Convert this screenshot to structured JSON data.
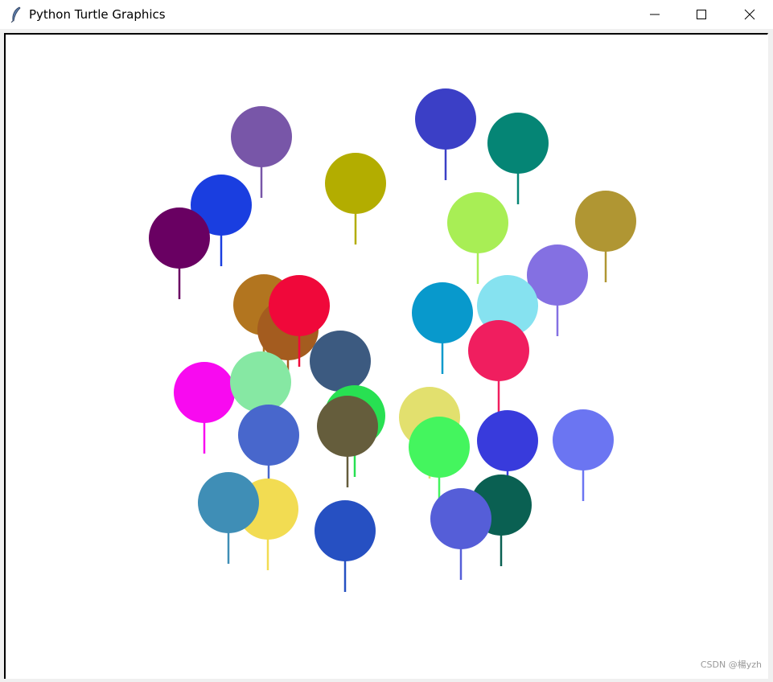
{
  "window": {
    "title": "Python Turtle Graphics",
    "icon": "feather-icon",
    "controls": [
      "minimize-icon",
      "maximize-icon",
      "close-icon"
    ]
  },
  "canvas": {
    "background": "#ffffff",
    "balloons": [
      {
        "color": "#7856a8"
      },
      {
        "color": "#3b3fc6"
      },
      {
        "color": "#058575"
      },
      {
        "color": "#b3ad00"
      },
      {
        "color": "#1a3ee0"
      },
      {
        "color": "#690062"
      },
      {
        "color": "#a8ee55"
      },
      {
        "color": "#b09633"
      },
      {
        "color": "#8470e2"
      },
      {
        "color": "#b2751f"
      },
      {
        "color": "#a45c1f"
      },
      {
        "color": "#f0083a"
      },
      {
        "color": "#0899cc"
      },
      {
        "color": "#86e2f0"
      },
      {
        "color": "#f01e5f"
      },
      {
        "color": "#3c5a80"
      },
      {
        "color": "#f80af0"
      },
      {
        "color": "#86e8a3"
      },
      {
        "color": "#4867cc"
      },
      {
        "color": "#28e052"
      },
      {
        "color": "#655d3c"
      },
      {
        "color": "#e2e06e"
      },
      {
        "color": "#44f55e"
      },
      {
        "color": "#383bdc"
      },
      {
        "color": "#6b75f2"
      },
      {
        "color": "#0a6052"
      },
      {
        "color": "#f2dc52"
      },
      {
        "color": "#3f8eb6"
      },
      {
        "color": "#2650c2"
      },
      {
        "color": "#555ed8"
      }
    ]
  },
  "watermark": "CSDN @楊yzh"
}
